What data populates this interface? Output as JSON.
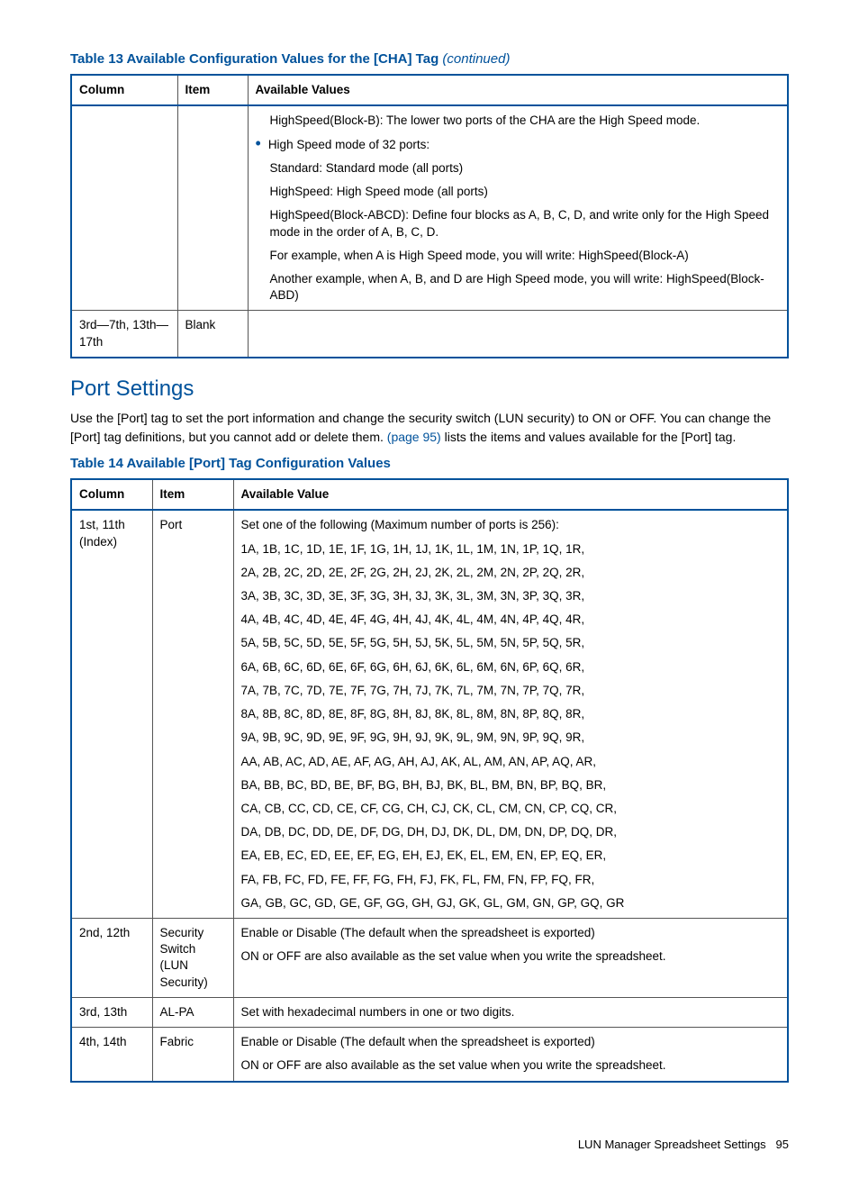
{
  "table13": {
    "caption": "Table 13 Available Configuration Values for the [CHA] Tag",
    "continued": "(continued)",
    "headers": {
      "c1": "Column",
      "c2": "Item",
      "c3": "Available Values"
    },
    "row1": {
      "col": "",
      "item": "",
      "v1": "HighSpeed(Block-B): The lower two ports of the CHA are the High Speed mode.",
      "v2": "High Speed mode of 32 ports:",
      "v3": "Standard: Standard mode (all ports)",
      "v4": "HighSpeed: High Speed mode (all ports)",
      "v5": "HighSpeed(Block-ABCD): Define four blocks as A, B, C, D, and write only for the High Speed mode in the order of A, B, C, D.",
      "v6": "For example, when A is High Speed mode, you will write: HighSpeed(Block-A)",
      "v7": "Another example, when A, B, and D are High Speed mode, you will write: HighSpeed(Block-ABD)"
    },
    "row2": {
      "col": "3rd—7th, 13th—17th",
      "item": "Blank",
      "val": ""
    }
  },
  "section": {
    "title": "Port Settings",
    "para_a": "Use the [Port] tag to set the port information and change the security switch (LUN security) to ON or OFF. You can change the [Port] tag definitions, but you cannot add or delete them. ",
    "para_link": "(page 95)",
    "para_b": " lists the items and values available for the [Port] tag."
  },
  "table14": {
    "caption": "Table 14 Available [Port] Tag Configuration Values",
    "headers": {
      "c1": "Column",
      "c2": "Item",
      "c3": "Available Value"
    },
    "row1": {
      "col": "1st, 11th (Index)",
      "item": "Port",
      "v0": "Set one of the following (Maximum number of ports is 256):",
      "v1": "1A, 1B, 1C, 1D, 1E, 1F, 1G, 1H, 1J, 1K, 1L, 1M, 1N, 1P, 1Q, 1R,",
      "v2": "2A, 2B, 2C, 2D, 2E, 2F, 2G, 2H, 2J, 2K, 2L, 2M, 2N, 2P, 2Q, 2R,",
      "v3": "3A, 3B, 3C, 3D, 3E, 3F, 3G, 3H, 3J, 3K, 3L, 3M, 3N, 3P, 3Q, 3R,",
      "v4": "4A, 4B, 4C, 4D, 4E, 4F, 4G, 4H, 4J, 4K, 4L, 4M, 4N, 4P, 4Q, 4R,",
      "v5": "5A, 5B, 5C, 5D, 5E, 5F, 5G, 5H, 5J, 5K, 5L, 5M, 5N, 5P, 5Q, 5R,",
      "v6": "6A, 6B, 6C, 6D, 6E, 6F, 6G, 6H, 6J, 6K, 6L, 6M, 6N, 6P, 6Q, 6R,",
      "v7": "7A, 7B, 7C, 7D, 7E, 7F, 7G, 7H, 7J, 7K, 7L, 7M, 7N, 7P, 7Q, 7R,",
      "v8": "8A, 8B, 8C, 8D, 8E, 8F, 8G, 8H, 8J, 8K, 8L, 8M, 8N, 8P, 8Q, 8R,",
      "v9": "9A, 9B, 9C, 9D, 9E, 9F, 9G, 9H, 9J, 9K, 9L, 9M, 9N, 9P, 9Q, 9R,",
      "vA": "AA, AB, AC, AD, AE, AF, AG, AH, AJ, AK, AL, AM, AN, AP, AQ, AR,",
      "vB": "BA, BB, BC, BD, BE, BF, BG, BH, BJ, BK, BL, BM, BN, BP, BQ, BR,",
      "vC": "CA, CB, CC, CD, CE, CF, CG, CH, CJ, CK, CL, CM, CN, CP, CQ, CR,",
      "vD": "DA, DB, DC, DD, DE, DF, DG, DH, DJ, DK, DL, DM, DN, DP, DQ, DR,",
      "vE": "EA, EB, EC, ED, EE, EF, EG, EH, EJ, EK, EL, EM, EN, EP, EQ, ER,",
      "vF": "FA, FB, FC, FD, FE, FF, FG, FH, FJ, FK, FL, FM, FN, FP, FQ, FR,",
      "vG": "GA, GB, GC, GD, GE, GF, GG, GH, GJ, GK, GL, GM, GN, GP, GQ, GR"
    },
    "row2": {
      "col": "2nd, 12th",
      "item": "Security Switch (LUN Security)",
      "v1": "Enable or Disable (The default when the spreadsheet is exported)",
      "v2": "ON or OFF are also available as the set value when you write the spreadsheet."
    },
    "row3": {
      "col": "3rd, 13th",
      "item": "AL-PA",
      "v1": "Set with hexadecimal numbers in one or two digits."
    },
    "row4": {
      "col": "4th, 14th",
      "item": "Fabric",
      "v1": "Enable or Disable (The default when the spreadsheet is exported)",
      "v2": "ON or OFF are also available as the set value when you write the spreadsheet."
    }
  },
  "footer": {
    "text": "LUN Manager Spreadsheet Settings",
    "page": "95"
  }
}
